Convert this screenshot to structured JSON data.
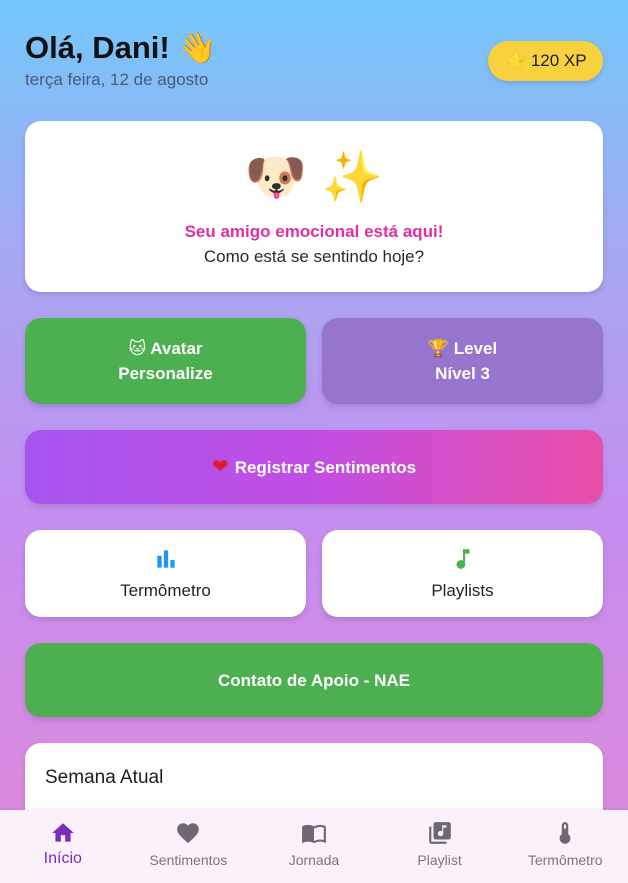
{
  "header": {
    "greeting": "Olá, Dani! 👋",
    "date": "terça feira, 12 de agosto",
    "xp_star": "⭐",
    "xp": "120 XP"
  },
  "hero": {
    "emoji_dog": "🐶",
    "emoji_sparkles": "✨",
    "title": "Seu amigo emocional está aqui!",
    "subtitle": "Como está se sentindo hoje?"
  },
  "tiles": {
    "avatar": {
      "line1": "🐱 Avatar",
      "line2": "Personalize"
    },
    "level": {
      "line1": "🏆 Level",
      "line2": "Nível 3"
    }
  },
  "register": {
    "heart": "❤",
    "label": "Registrar Sentimentos"
  },
  "cards": {
    "thermometer": {
      "label": "Termômetro",
      "icon": "bar-chart-icon"
    },
    "playlists": {
      "label": "Playlists",
      "icon": "music-note-icon"
    }
  },
  "support": {
    "label": "Contato de Apoio - NAE"
  },
  "week": {
    "title": "Semana Atual"
  },
  "nav": {
    "items": [
      {
        "label": "Início",
        "icon": "home-icon",
        "active": true
      },
      {
        "label": "Sentimentos",
        "icon": "heart-icon"
      },
      {
        "label": "Jornada",
        "icon": "book-icon"
      },
      {
        "label": "Playlist",
        "icon": "library-music-icon"
      },
      {
        "label": "Termômetro",
        "icon": "thermometer-icon"
      }
    ]
  },
  "colors": {
    "accent_green": "#4caf50",
    "accent_purple": "#9575cd",
    "pink_title": "#e22fa2",
    "nav_active": "#7b2cbf",
    "xp_badge": "#f7d23e"
  }
}
